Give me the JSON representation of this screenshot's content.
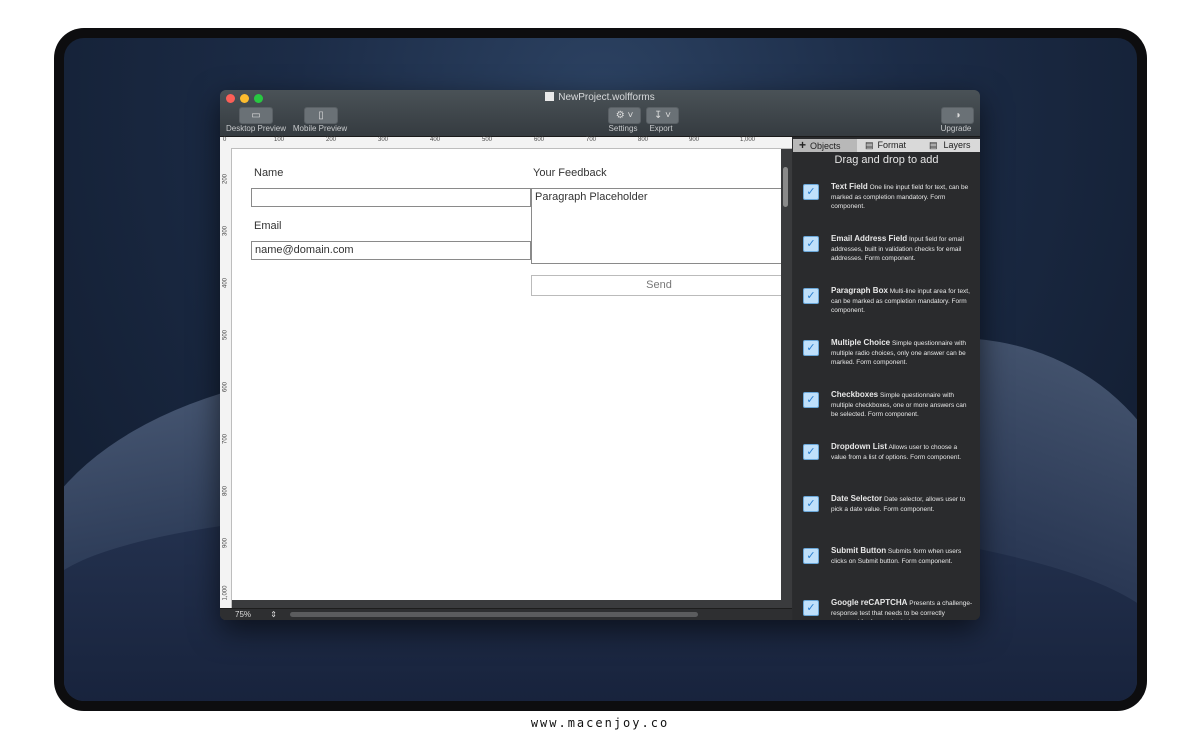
{
  "watermark": "www.macenjoy.co",
  "window": {
    "title": "NewProject.wolfforms",
    "toolbar": {
      "desktop_preview": "Desktop Preview",
      "mobile_preview": "Mobile Preview",
      "settings": "Settings",
      "export": "Export",
      "upgrade": "Upgrade"
    }
  },
  "ruler": {
    "top": [
      "0",
      "100",
      "200",
      "300",
      "400",
      "500",
      "600",
      "700",
      "800",
      "900",
      "1,000"
    ],
    "left": [
      "200",
      "300",
      "400",
      "500",
      "600",
      "700",
      "800",
      "900",
      "1,000"
    ]
  },
  "form": {
    "name_label": "Name",
    "name_value": "",
    "email_label": "Email",
    "email_placeholder": "name@domain.com",
    "feedback_label": "Your Feedback",
    "feedback_placeholder": "Paragraph Placeholder",
    "send_label": "Send"
  },
  "zoom": "75%",
  "panel": {
    "tabs": [
      "Objects",
      "Format",
      "Layers"
    ],
    "active_tab": "Objects",
    "heading": "Drag and drop to add",
    "items": [
      {
        "name": "Text Field",
        "desc": "One line input field for text, can be marked as completion mandatory.  Form component."
      },
      {
        "name": "Email Address Field",
        "desc": "Input field for email addresses, built in validation checks for email addresses.  Form component."
      },
      {
        "name": "Paragraph Box",
        "desc": "Multi-line input area for text, can be marked as completion mandatory.  Form component."
      },
      {
        "name": "Multiple Choice",
        "desc": "Simple questionnaire with multiple radio choices, only one answer can be marked.  Form component."
      },
      {
        "name": "Checkboxes",
        "desc": "Simple questionnaire with multiple checkboxes, one or more answers can be selected.  Form component."
      },
      {
        "name": "Dropdown List",
        "desc": "Allows user to choose a value from a list of options.  Form component."
      },
      {
        "name": "Date Selector",
        "desc": "Date selector, allows user to pick a date value.  Form component."
      },
      {
        "name": "Submit Button",
        "desc": "Submits form when users clicks on Submit button.  Form component."
      },
      {
        "name": "Google reCAPTCHA",
        "desc": "Presents a challenge-response test that needs to be correctly answered for form submission."
      }
    ]
  },
  "colors": {
    "close": "#fc5f57",
    "minimize": "#fdbc2e",
    "maximize": "#28c841",
    "checkbox": "#bfe0fb"
  }
}
